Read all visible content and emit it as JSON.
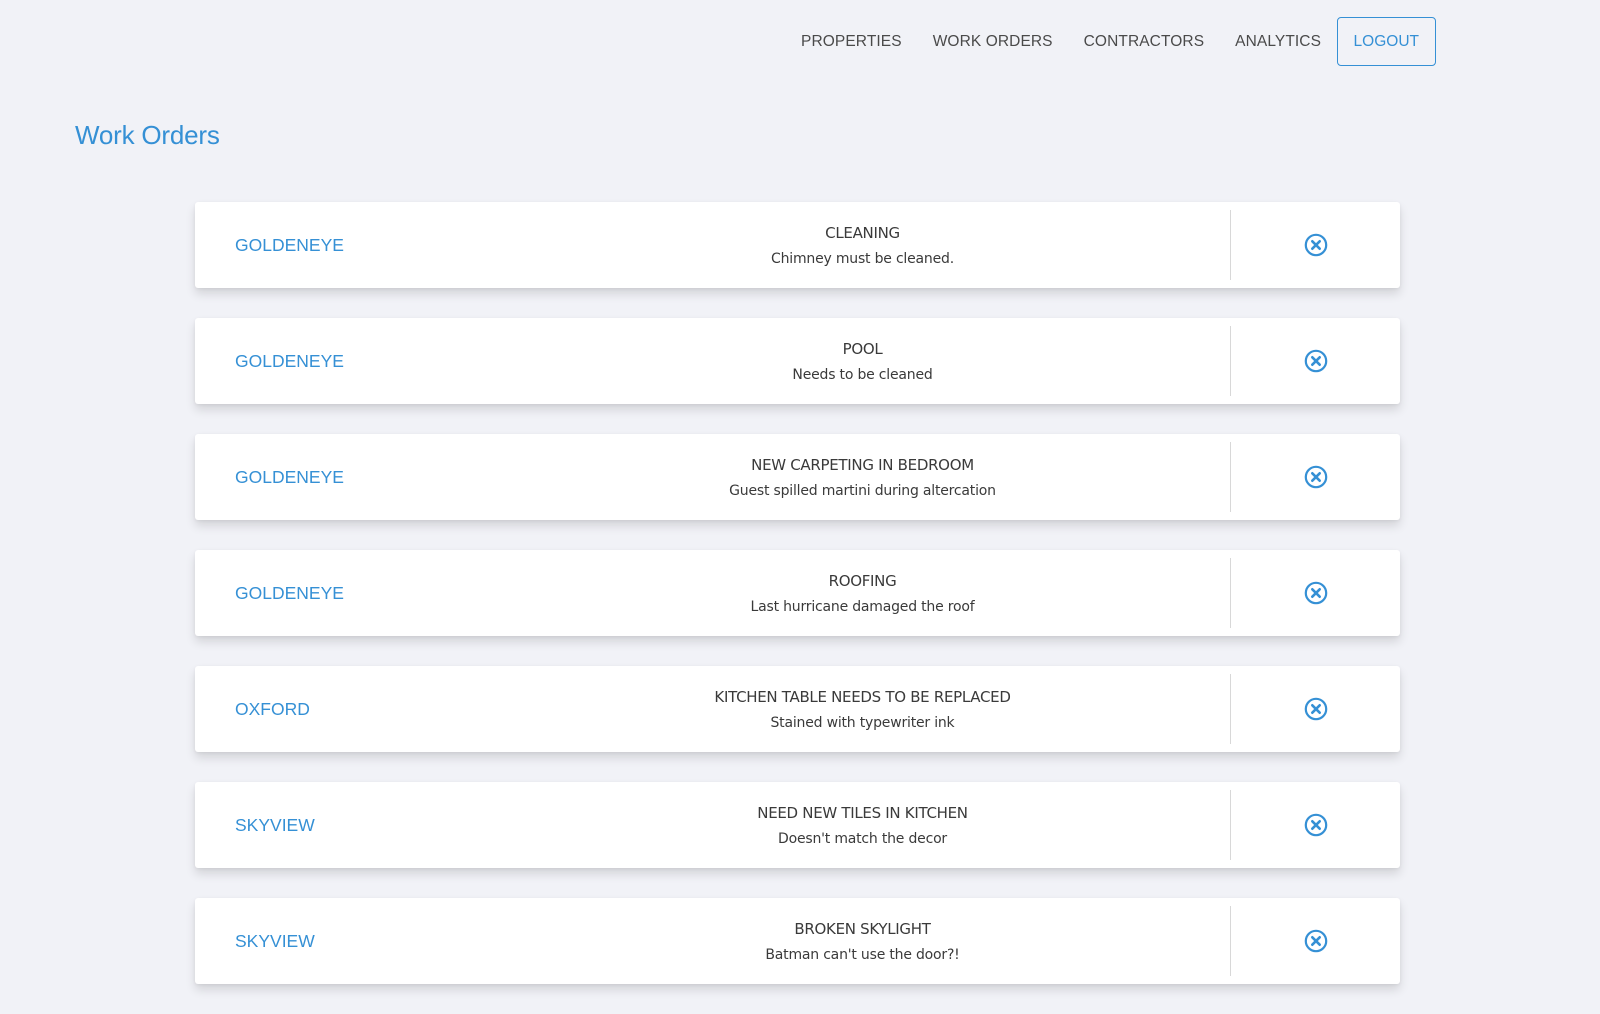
{
  "nav": {
    "items": [
      {
        "label": "PROPERTIES"
      },
      {
        "label": "WORK ORDERS"
      },
      {
        "label": "CONTRACTORS"
      },
      {
        "label": "ANALYTICS"
      }
    ],
    "logout_label": "LOGOUT"
  },
  "page": {
    "title": "Work Orders"
  },
  "colors": {
    "accent": "#3590d5",
    "background": "#f1f2f7",
    "card": "#ffffff",
    "text": "#3a3a3a"
  },
  "work_orders": [
    {
      "property": "GOLDENEYE",
      "title": "CLEANING",
      "description": "Chimney must be cleaned.",
      "action_icon": "circle-x-icon"
    },
    {
      "property": "GOLDENEYE",
      "title": "POOL",
      "description": "Needs to be cleaned",
      "action_icon": "circle-x-icon"
    },
    {
      "property": "GOLDENEYE",
      "title": "NEW CARPETING IN BEDROOM",
      "description": "Guest spilled martini during altercation",
      "action_icon": "circle-x-icon"
    },
    {
      "property": "GOLDENEYE",
      "title": "ROOFING",
      "description": "Last hurricane damaged the roof",
      "action_icon": "circle-x-icon"
    },
    {
      "property": "OXFORD",
      "title": "KITCHEN TABLE NEEDS TO BE REPLACED",
      "description": "Stained with typewriter ink",
      "action_icon": "circle-x-icon"
    },
    {
      "property": "SKYVIEW",
      "title": "NEED NEW TILES IN KITCHEN",
      "description": "Doesn't match the decor",
      "action_icon": "circle-x-icon"
    },
    {
      "property": "SKYVIEW",
      "title": "BROKEN SKYLIGHT",
      "description": "Batman can't use the door?!",
      "action_icon": "circle-x-icon"
    }
  ]
}
